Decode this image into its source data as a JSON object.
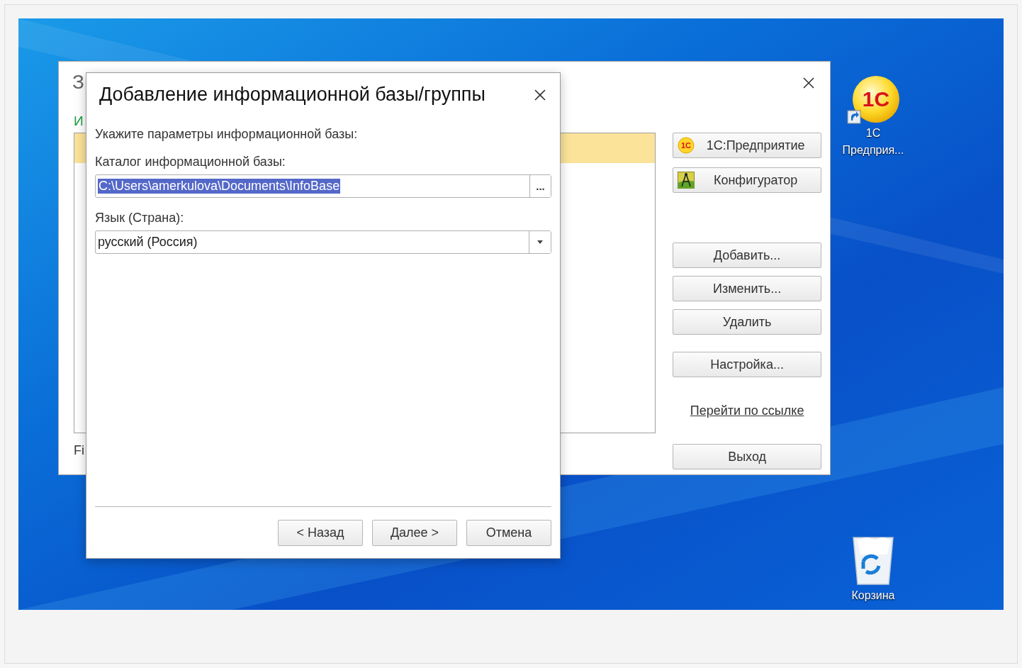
{
  "background_window": {
    "title": "З",
    "subtitle": "И",
    "list_rows": [
      {
        "selected": true
      }
    ],
    "footer": "Fi",
    "buttons": [
      {
        "label": "1С:Предприятие",
        "kind": "enterprise",
        "icon_text": "1С"
      },
      {
        "label": "Конфигуратор",
        "kind": "designer"
      },
      {
        "label": "Добавить...",
        "kind": "action"
      },
      {
        "label": "Изменить...",
        "kind": "action"
      },
      {
        "label": "Удалить",
        "kind": "action"
      },
      {
        "label": "Настройка...",
        "kind": "settings"
      },
      {
        "label": "Перейти по ссылке",
        "kind": "link"
      },
      {
        "label": "Выход",
        "kind": "exit"
      }
    ]
  },
  "dialog": {
    "title": "Добавление информационной базы/группы",
    "prompt": "Укажите параметры информационной базы:",
    "fields": [
      {
        "kind": "path",
        "label": "Каталог информационной базы:",
        "value": "C:\\Users\\amerkulova\\Documents\\InfoBase",
        "selected": true,
        "button": "..."
      },
      {
        "kind": "dropdown",
        "label": "Язык (Страна):",
        "value": "русский (Россия)",
        "selected": false
      }
    ],
    "buttons": [
      "< Назад",
      "Далее >",
      "Отмена"
    ]
  },
  "desktop_icons": [
    {
      "kind": "shortcut",
      "label": "1С Предприя...",
      "icon_text": "1С"
    },
    {
      "kind": "recycle_bin",
      "label": "Корзина"
    }
  ]
}
